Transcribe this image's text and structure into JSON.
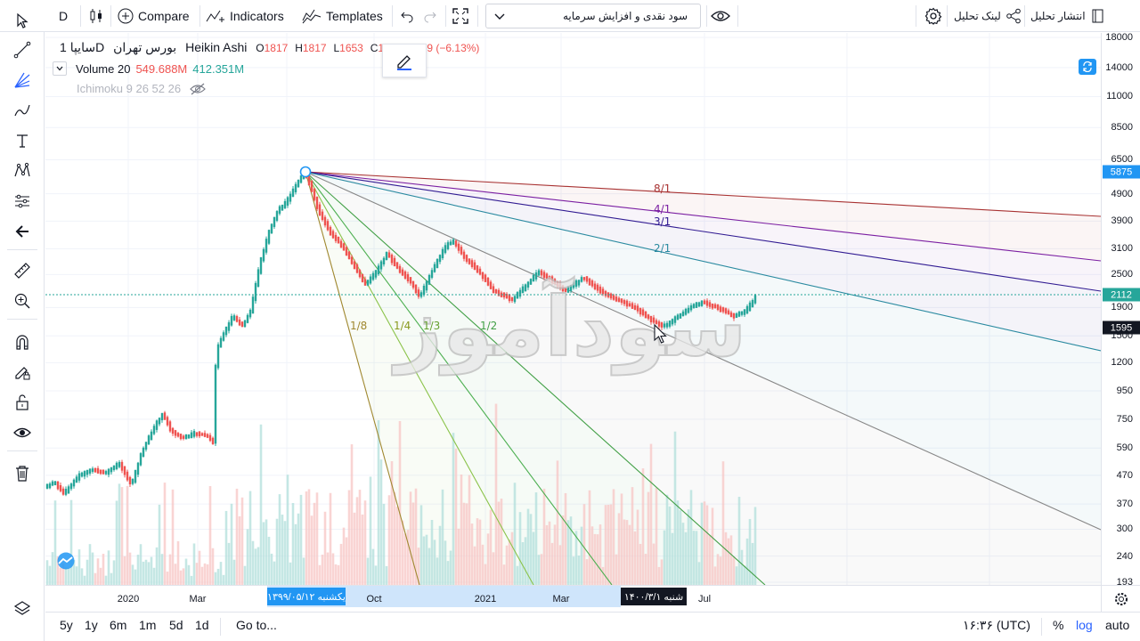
{
  "toolbar": {
    "symbol_search": "D",
    "compare": "Compare",
    "indicators": "Indicators",
    "templates": "Templates",
    "layout_name": "سود نقدی و افزایش سرمایه",
    "share_link": "لینک تحلیل",
    "publish": "انتشار تحلیل"
  },
  "legend": {
    "symbol": "سایپا",
    "interval": "1D",
    "exchange": "بورس تهران",
    "chart_style": "Heikin Ashi",
    "open_label": "O",
    "open": "1817",
    "high_label": "H",
    "high": "1817",
    "low_label": "L",
    "low": "1653",
    "close_label": "C",
    "close": "1663",
    "change": "−109 (−6.13%)",
    "volume_label": "Volume 20",
    "volume_value": "549.688M",
    "volume_ma": "412.351M",
    "ichimoku": "Ichimoku 9 26 52 26"
  },
  "price_axis": {
    "labels": [
      "18000",
      "14000",
      "11000",
      "8500",
      "6500",
      "4900",
      "3900",
      "3100",
      "2500",
      "1900",
      "1500",
      "1200",
      "950",
      "750",
      "590",
      "470",
      "370",
      "300",
      "240",
      "193"
    ],
    "badges": [
      {
        "text": "5875",
        "color": "#2196f3"
      },
      {
        "text": "2112",
        "color": "#26a69a"
      },
      {
        "text": "1595",
        "color": "#131722"
      }
    ]
  },
  "time_axis": {
    "labels": [
      "2020",
      "Mar",
      "Oct",
      "2021",
      "Mar",
      "Jul"
    ],
    "range_start": "یکشنبه ۱۳۹۹/۰۵/۱۲",
    "crosshair": "شنبه ۱۴۰۰/۳/۱"
  },
  "gann_fan": {
    "labels": [
      "8/1",
      "4/1",
      "3/1",
      "2/1",
      "1/2",
      "1/3",
      "1/4",
      "1/8"
    ],
    "colors": {
      "8/1": "#a83232",
      "4/1": "#7b1fa2",
      "3/1": "#311b92",
      "2/1": "#2a8aa0",
      "1/1": "#888888",
      "1/2": "#43a047",
      "1/3": "#4caf50",
      "1/4": "#8bc34a",
      "1/8": "#a08830"
    }
  },
  "bottom_bar": {
    "ranges": [
      "5y",
      "1y",
      "6m",
      "1m",
      "5d",
      "1d"
    ],
    "goto": "Go to...",
    "time": "۱۶:۳۶ (UTC)",
    "percent": "%",
    "log": "log",
    "auto": "auto"
  },
  "watermark": {
    "text": "سودآموز"
  },
  "colors": {
    "up": "#26a69a",
    "down": "#ef5350",
    "accent": "#2962ff"
  }
}
